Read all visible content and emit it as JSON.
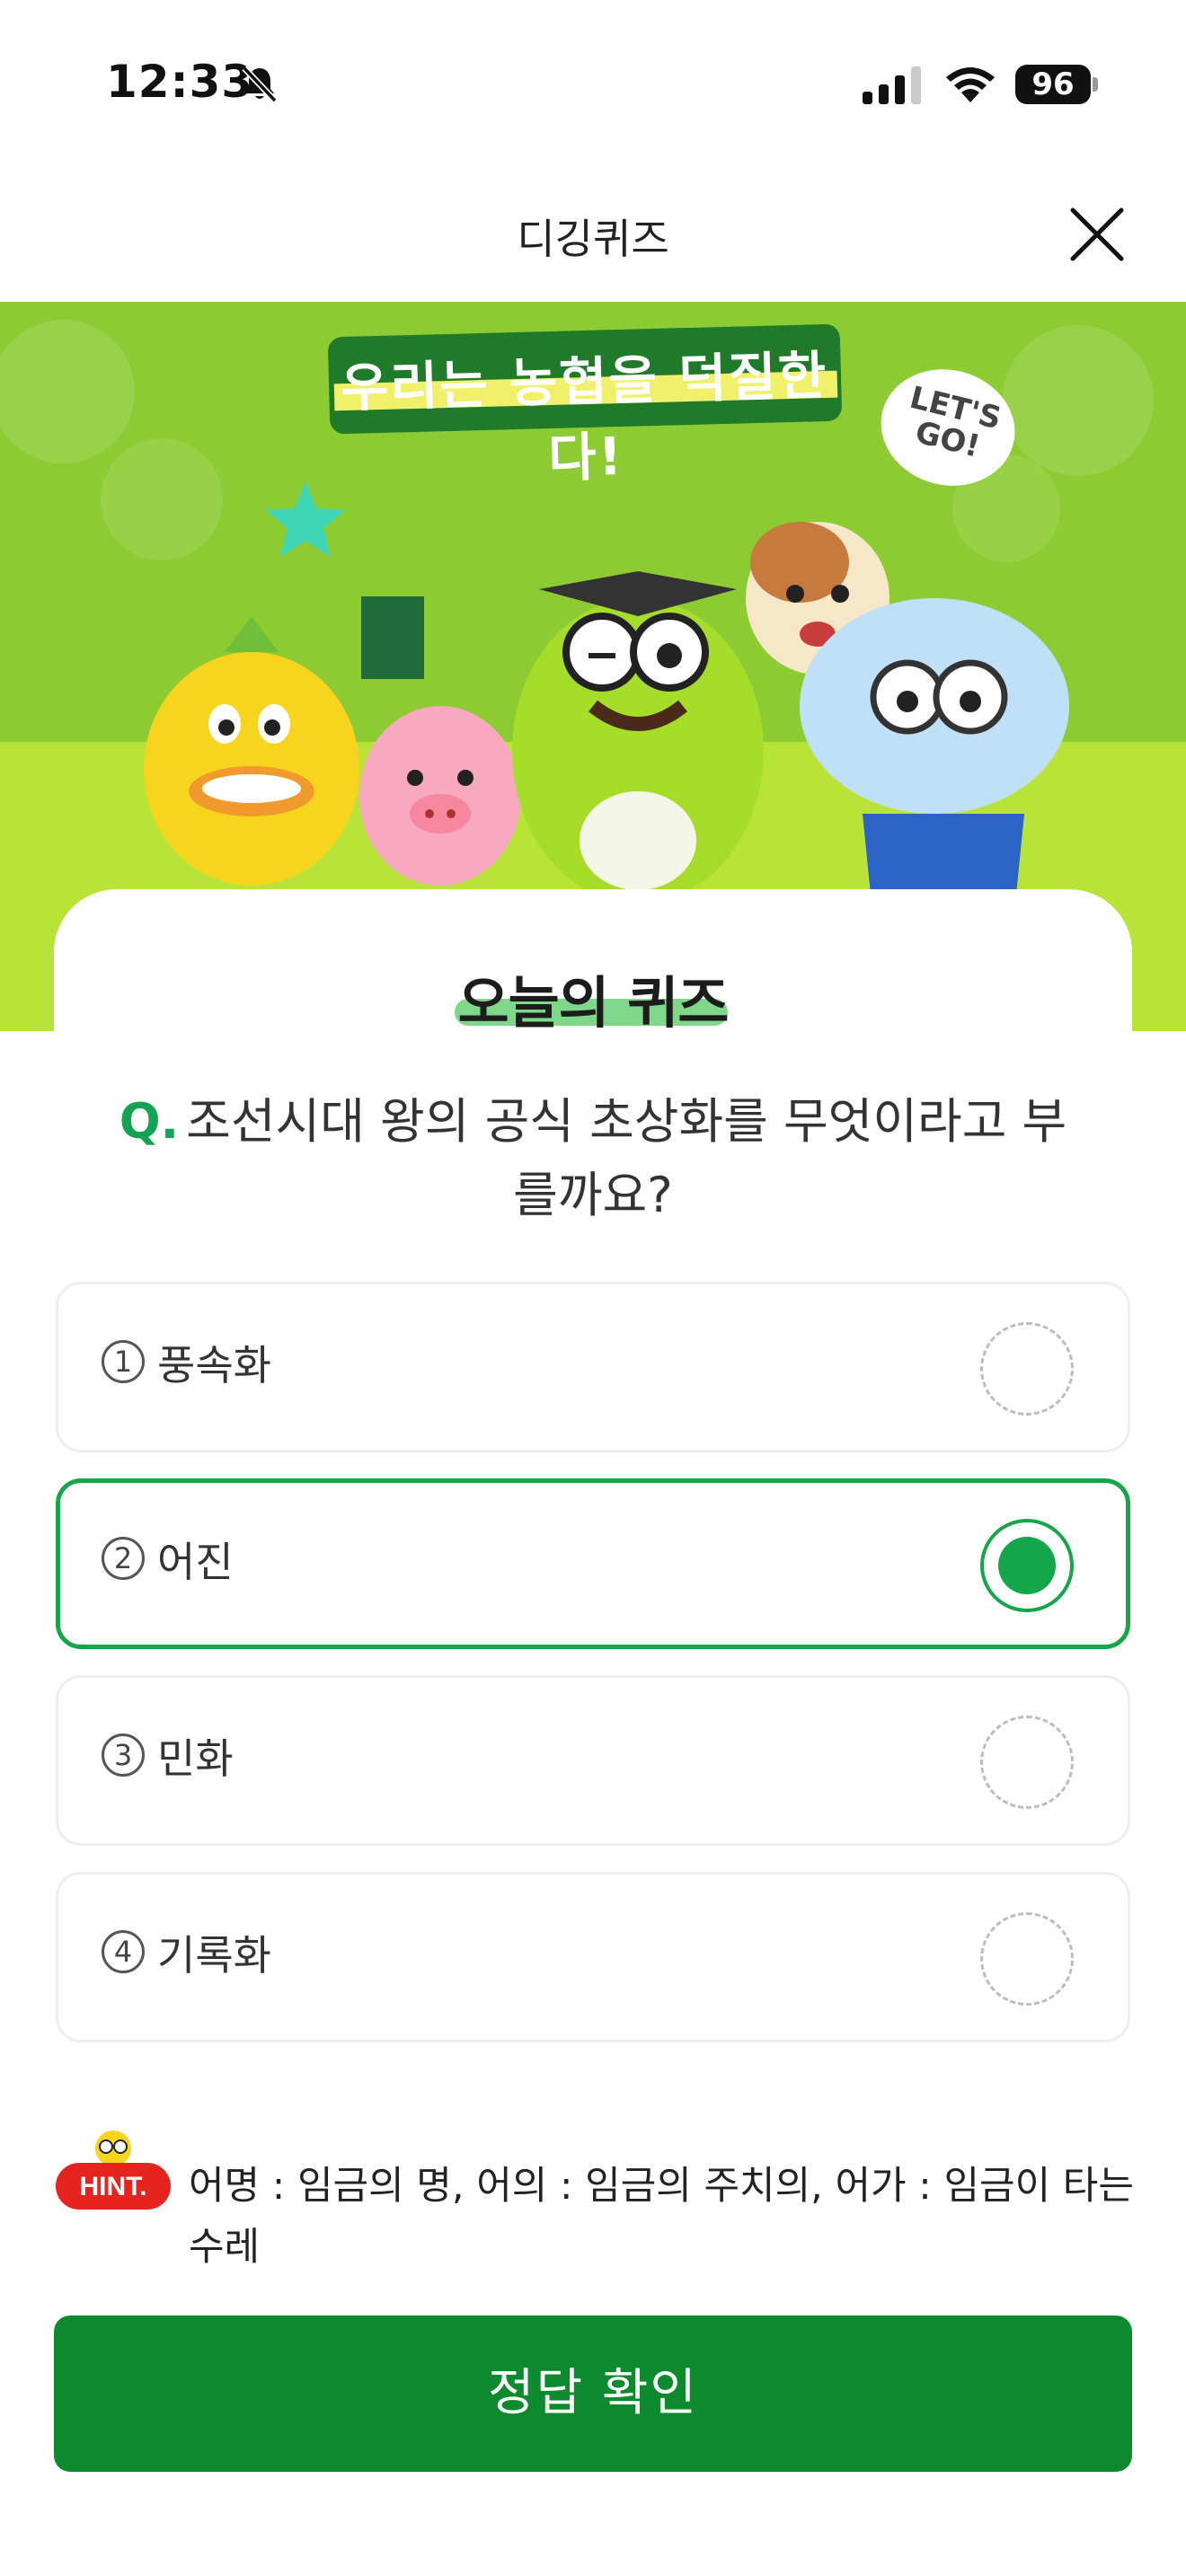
{
  "status_bar": {
    "time": "12:33",
    "battery": "96"
  },
  "header": {
    "title": "디깅퀴즈"
  },
  "banner": {
    "slogan": "우리는 농협을 덕질한다!",
    "bubble": "LET'S GO!"
  },
  "quiz": {
    "title": "오늘의 퀴즈",
    "question_marker": "Q.",
    "question": "조선시대 왕의 공식 초상화를 무엇이라고 부를까요?",
    "options": [
      {
        "num": "1",
        "label": "풍속화",
        "selected": false
      },
      {
        "num": "2",
        "label": "어진",
        "selected": true
      },
      {
        "num": "3",
        "label": "민화",
        "selected": false
      },
      {
        "num": "4",
        "label": "기록화",
        "selected": false
      }
    ]
  },
  "hint": {
    "badge": "HINT.",
    "text": "어명 : 임금의 명, 어의 : 임금의 주치의, 어가 : 임금이 타는 수레"
  },
  "submit": {
    "label": "정답 확인"
  },
  "colors": {
    "accent": "#15a64b",
    "button": "#0d8a2d",
    "banner": "#8ccb32",
    "hint_red": "#e52420"
  }
}
